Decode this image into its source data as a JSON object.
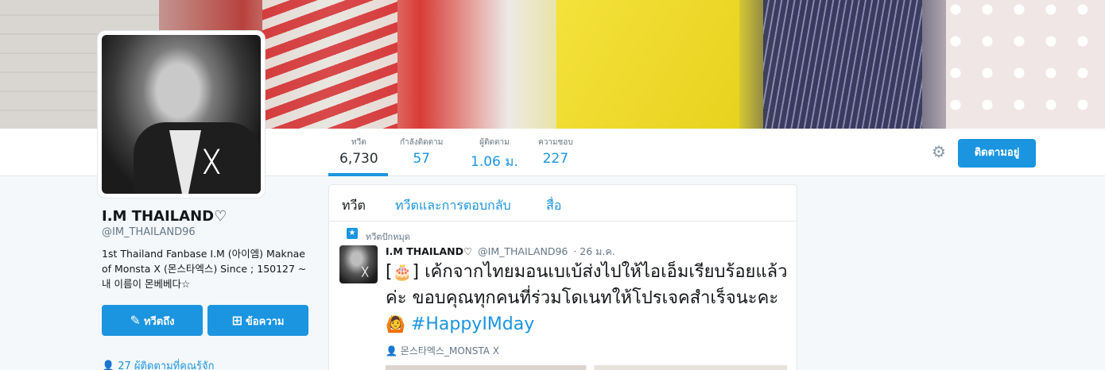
{
  "profile": {
    "name": "I.M THAILAND♡",
    "handle": "@IM_THAILAND96",
    "bio": "1st Thailand Fanbase I.M (아이엠) Maknae of Monsta X (몬스타엑스) Since ; 150127 ~ 내 이름이 몬베베다☆",
    "tweet_to_label": "ทวีตถึง",
    "message_label": "ข้อความ",
    "followers_you_know": "27 ผู้ติดตามที่คุณรู้จัก"
  },
  "stats": [
    {
      "label": "ทวีต",
      "value": "6,730"
    },
    {
      "label": "กำลังติดตาม",
      "value": "57"
    },
    {
      "label": "ผู้ติดตาม",
      "value": "1.06 ม."
    },
    {
      "label": "ความชอบ",
      "value": "227"
    }
  ],
  "header": {
    "follow_button": "ติดตามอยู่",
    "settings_icon": "gear-icon"
  },
  "timeline": {
    "tabs": [
      "ทวีต",
      "ทวีตและการตอบกลับ",
      "สื่อ"
    ],
    "pinned_label": "ทวีตปักหมุด",
    "tweet": {
      "name": "I.M THAILAND♡",
      "handle": "@IM_THAILAND96",
      "time": "· 26 ม.ค.",
      "text_prefix": "[",
      "text_emoji_cake": "🎂",
      "text_main": "] เค้กจากไทยมอนเบเบ้ส่งไปให้ไอเอ็มเรียบร้อยแล้วค่ะ ขอบคุณทุกคนที่ร่วมโดเนทให้โปรเจคสำเร็จนะคะ",
      "text_emoji_person": "🙆",
      "hashtag": "#HappyIMday",
      "mention": "몬스타엑스_MONSTA X"
    }
  },
  "colors": {
    "accent": "#1b95e0",
    "text": "#14171a",
    "muted": "#657786"
  }
}
